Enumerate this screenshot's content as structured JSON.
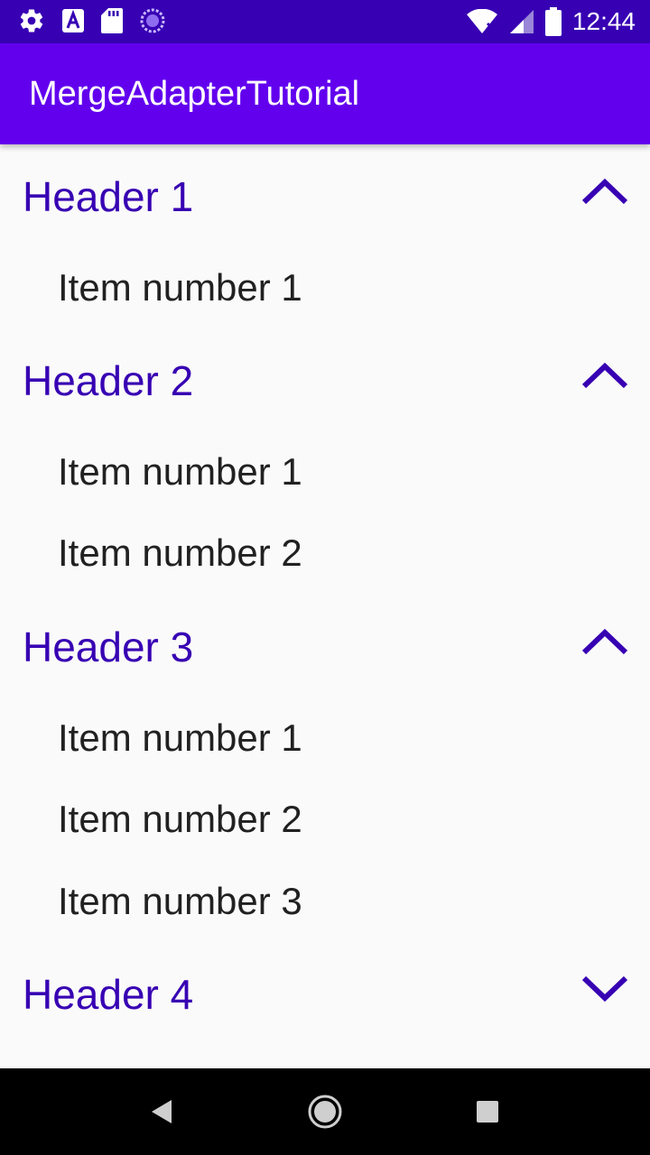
{
  "status_bar": {
    "time": "12:44",
    "icons": [
      "settings-icon",
      "font-icon",
      "sd-card-icon",
      "sync-icon",
      "wifi-icon",
      "signal-icon",
      "battery-icon"
    ]
  },
  "app_bar": {
    "title": "MergeAdapterTutorial"
  },
  "sections": [
    {
      "header": "Header 1",
      "expanded": true,
      "items": [
        "Item number 1"
      ]
    },
    {
      "header": "Header 2",
      "expanded": true,
      "items": [
        "Item number 1",
        "Item number 2"
      ]
    },
    {
      "header": "Header 3",
      "expanded": true,
      "items": [
        "Item number 1",
        "Item number 2",
        "Item number 3"
      ]
    },
    {
      "header": "Header 4",
      "expanded": false,
      "items": []
    }
  ],
  "colors": {
    "status_bar": "#3700b3",
    "app_bar": "#6200ee",
    "header_text": "#3700b3",
    "item_text": "#212121",
    "background": "#fafafa"
  },
  "nav_bar": {
    "icons": [
      "back-icon",
      "home-icon",
      "recents-icon"
    ]
  }
}
